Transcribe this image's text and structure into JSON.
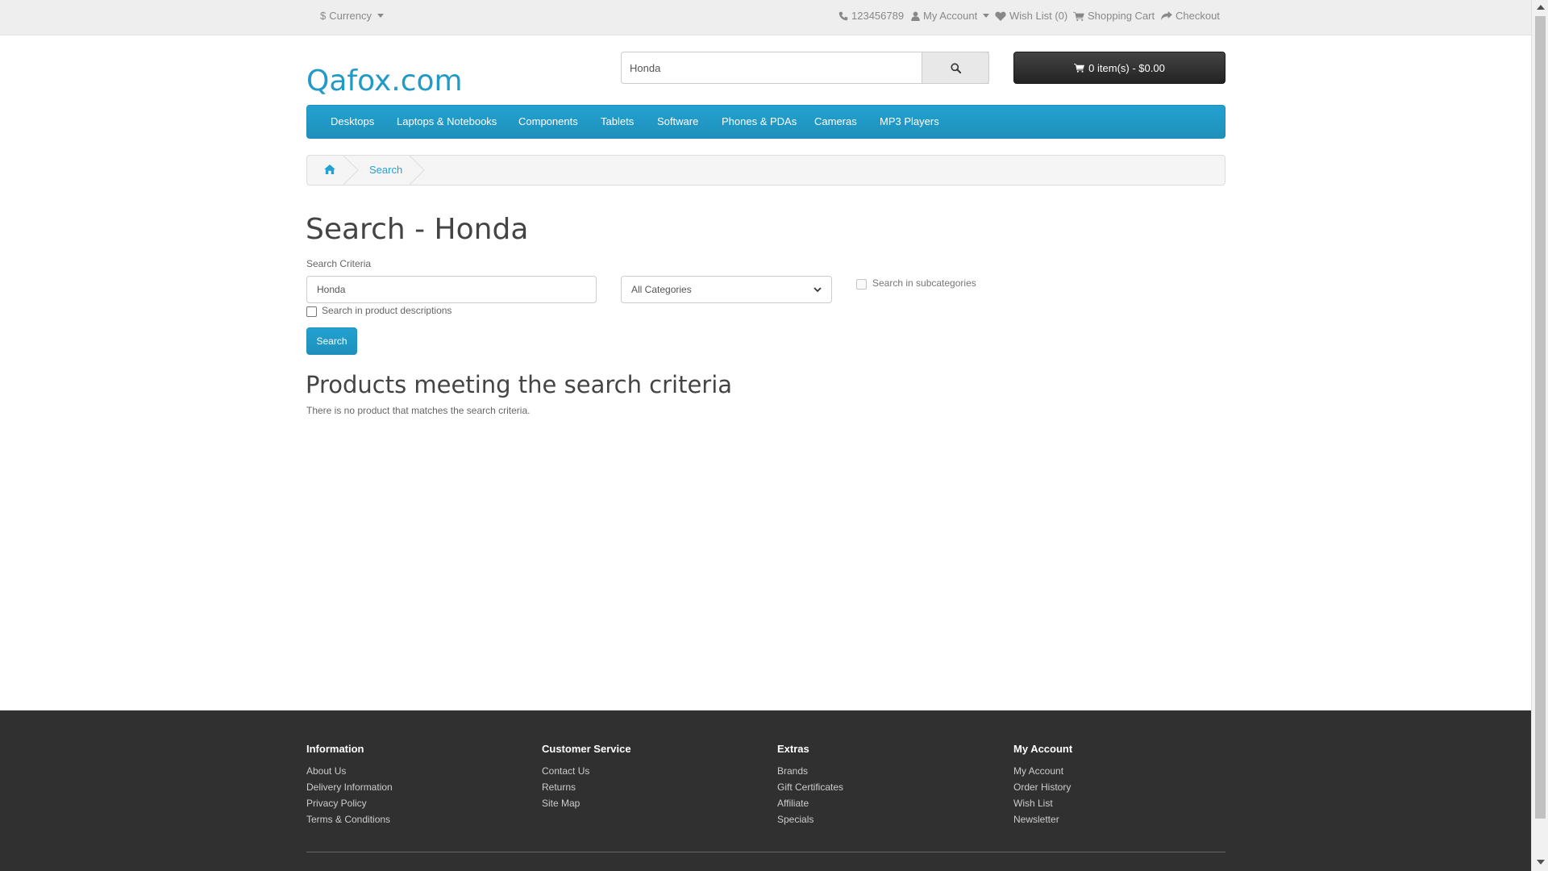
{
  "topbar": {
    "currency_symbol": "$",
    "currency_label": "Currency",
    "phone": "123456789",
    "my_account": "My Account",
    "wish_list": "Wish List (0)",
    "shopping_cart": "Shopping Cart",
    "checkout": "Checkout"
  },
  "header": {
    "logo": "Qafox.com",
    "search_value": "Honda",
    "cart_label": "0 item(s) - $0.00"
  },
  "menu": {
    "items": [
      "Desktops",
      "Laptops & Notebooks",
      "Components",
      "Tablets",
      "Software",
      "Phones & PDAs",
      "Cameras",
      "MP3 Players"
    ]
  },
  "breadcrumb": {
    "home_icon": "home-icon",
    "current": "Search"
  },
  "main": {
    "title": "Search - Honda",
    "criteria_label": "Search Criteria",
    "criteria_value": "Honda",
    "category_selected": "All Categories",
    "subcategories_label": "Search in subcategories",
    "descriptions_label": "Search in product descriptions",
    "search_button": "Search",
    "results_title": "Products meeting the search criteria",
    "no_results": "There is no product that matches the search criteria."
  },
  "footer": {
    "information": {
      "title": "Information",
      "links": [
        "About Us",
        "Delivery Information",
        "Privacy Policy",
        "Terms & Conditions"
      ]
    },
    "customer_service": {
      "title": "Customer Service",
      "links": [
        "Contact Us",
        "Returns",
        "Site Map"
      ]
    },
    "extras": {
      "title": "Extras",
      "links": [
        "Brands",
        "Gift Certificates",
        "Affiliate",
        "Specials"
      ]
    },
    "my_account": {
      "title": "My Account",
      "links": [
        "My Account",
        "Order History",
        "Wish List",
        "Newsletter"
      ]
    }
  },
  "colors": {
    "accent": "#229ac8",
    "cart_dark": "#363636",
    "footer_bg": "#303030"
  }
}
